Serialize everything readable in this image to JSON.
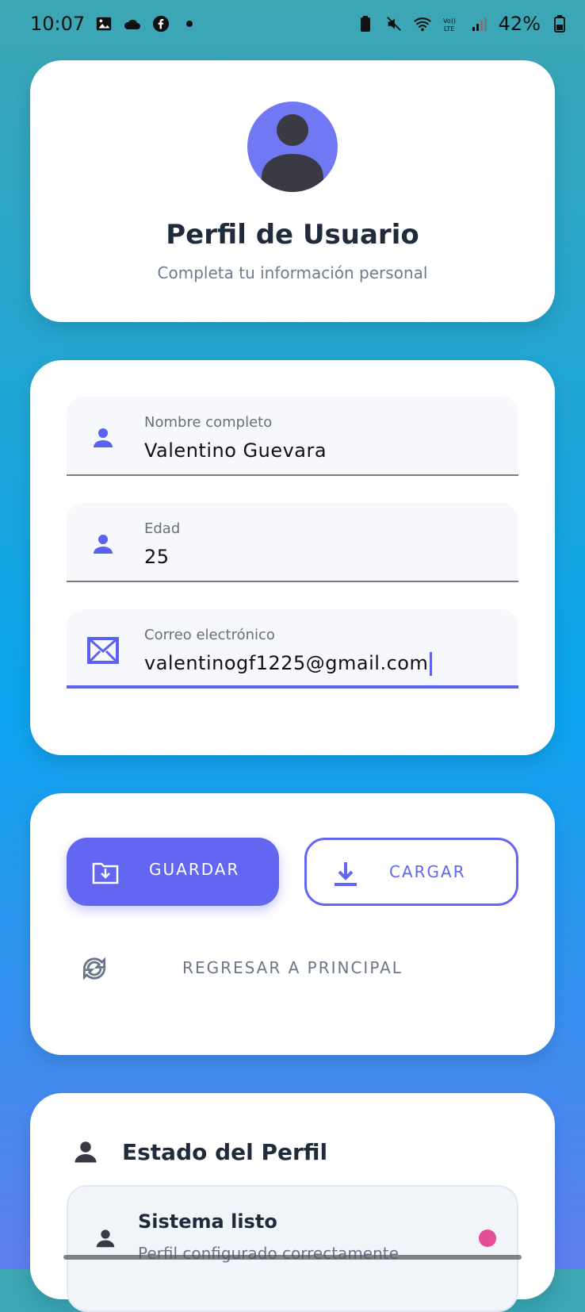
{
  "status_bar": {
    "time": "10:07",
    "battery": "42%"
  },
  "header": {
    "title": "Perfil de Usuario",
    "subtitle": "Completa tu información personal"
  },
  "form": {
    "fields": [
      {
        "label": "Nombre completo",
        "value": "Valentino Guevara",
        "icon": "person-icon"
      },
      {
        "label": "Edad",
        "value": "25",
        "icon": "person-icon"
      },
      {
        "label": "Correo electrónico",
        "value": "valentinogf1225@gmail.com",
        "icon": "email-icon"
      }
    ]
  },
  "actions": {
    "save_label": "GUARDAR",
    "load_label": "CARGAR",
    "back_label": "REGRESAR A PRINCIPAL"
  },
  "status": {
    "title": "Estado del Perfil",
    "item_title": "Sistema listo",
    "item_subtitle": "Perfil configurado correctamente"
  },
  "colors": {
    "accent": "#6266f1",
    "status_dot": "#e74d94"
  }
}
